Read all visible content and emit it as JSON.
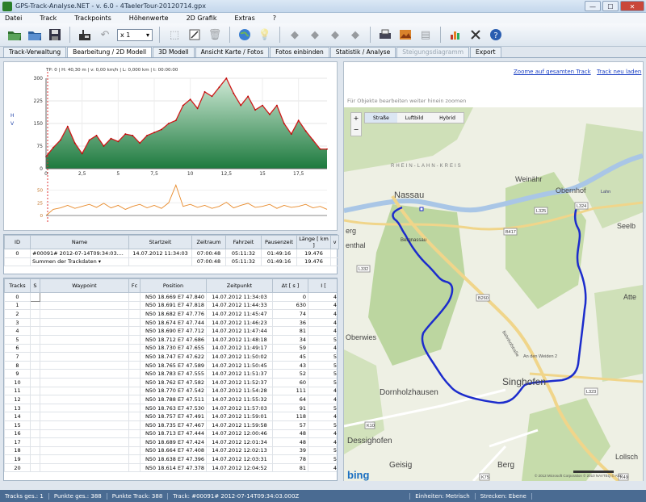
{
  "window": {
    "title": "GPS-Track-Analyse.NET  -  v. 6.0  -  4TaelerTour-20120714.gpx",
    "min": "—",
    "max": "☐",
    "close": "✕"
  },
  "menu": [
    "Datei",
    "Track",
    "Trackpoints",
    "Höhenwerte",
    "2D Grafik",
    "Extras",
    "?"
  ],
  "toolbar": {
    "zoom_value": "x 1"
  },
  "tabs": [
    {
      "label": "Track-Verwaltung",
      "state": "normal"
    },
    {
      "label": "Bearbeitung / 2D Modell",
      "state": "active"
    },
    {
      "label": "3D Modell",
      "state": "normal"
    },
    {
      "label": "Ansicht Karte / Fotos",
      "state": "normal"
    },
    {
      "label": "Fotos einbinden",
      "state": "normal"
    },
    {
      "label": "Statistik / Analyse",
      "state": "normal"
    },
    {
      "label": "Steigungsdiagramm",
      "state": "disabled"
    },
    {
      "label": "Export",
      "state": "normal"
    }
  ],
  "chart": {
    "info": "TP: 0 | H: 40,30 m | v: 0,00 km/h | L: 0,000 km | t: 00:00:00",
    "ylabel": "H\nV",
    "y_ticks": [
      "300",
      "225",
      "150",
      "75",
      "0"
    ],
    "x_ticks": [
      "0",
      "2,5",
      "5",
      "7,5",
      "10",
      "12,5",
      "15",
      "17,5"
    ],
    "speed_ticks": [
      "50",
      "25",
      "0"
    ]
  },
  "chart_data": [
    {
      "type": "area",
      "ylabel": "H",
      "ylim": [
        0,
        300
      ],
      "xlim": [
        0,
        19.476
      ],
      "x": [
        0,
        0.5,
        1,
        1.5,
        2,
        2.5,
        3,
        3.5,
        4,
        4.5,
        5,
        5.5,
        6,
        6.5,
        7,
        7.5,
        8,
        8.5,
        9,
        9.5,
        10,
        10.5,
        11,
        11.5,
        12,
        12.5,
        13,
        13.5,
        14,
        14.5,
        15,
        15.5,
        16,
        16.5,
        17,
        17.5,
        18,
        18.5,
        19,
        19.476
      ],
      "values": [
        40,
        70,
        95,
        140,
        85,
        50,
        95,
        110,
        75,
        100,
        90,
        115,
        110,
        85,
        110,
        120,
        130,
        150,
        160,
        210,
        230,
        200,
        255,
        240,
        270,
        300,
        250,
        210,
        240,
        195,
        210,
        180,
        210,
        150,
        115,
        160,
        125,
        95,
        65,
        65
      ]
    },
    {
      "type": "line",
      "ylabel": "V",
      "ylim": [
        0,
        70
      ],
      "xlim": [
        0,
        19.476
      ],
      "x": [
        0,
        0.5,
        1,
        1.5,
        2,
        2.5,
        3,
        3.5,
        4,
        4.5,
        5,
        5.5,
        6,
        6.5,
        7,
        7.5,
        8,
        8.5,
        9,
        9.5,
        10,
        10.5,
        11,
        11.5,
        12,
        12.5,
        13,
        13.5,
        14,
        14.5,
        15,
        15.5,
        16,
        16.5,
        17,
        17.5,
        18,
        18.5,
        19,
        19.476
      ],
      "values": [
        0,
        12,
        15,
        20,
        14,
        18,
        22,
        16,
        24,
        15,
        20,
        12,
        18,
        22,
        15,
        20,
        14,
        25,
        60,
        18,
        22,
        16,
        20,
        14,
        18,
        26,
        15,
        20,
        24,
        16,
        18,
        22,
        14,
        20,
        16,
        18,
        22,
        15,
        18,
        12
      ]
    }
  ],
  "tracks": {
    "headers": [
      "ID",
      "Name",
      "Startzeit",
      "Zeitraum",
      "Fahrzeit",
      "Pausenzeit",
      "Länge  [ km ]",
      "v"
    ],
    "rows": [
      [
        "0",
        "#00091# 2012-07-14T09:34:03....",
        "14.07.2012 11:34:03",
        "07:00:48",
        "05:11:32",
        "01:49:16",
        "19.476",
        ""
      ],
      [
        "",
        "Summen der Trackdaten ▾",
        "",
        "07:00:48",
        "05:11:32",
        "01:49:16",
        "19.476",
        ""
      ]
    ]
  },
  "waypoints": {
    "headers": [
      "Tracks",
      "S",
      "Waypoint",
      "Fc",
      "Position",
      "Zeitpunkt",
      "Δt\n[ s ]",
      "I\n["
    ],
    "rows": [
      [
        "0",
        "N50 18.669 E7 47.840",
        "14.07.2012 11:34:03",
        "0",
        "4"
      ],
      [
        "1",
        "N50 18.691 E7 47.818",
        "14.07.2012 11:44:33",
        "630",
        "4"
      ],
      [
        "2",
        "N50 18.682 E7 47.776",
        "14.07.2012 11:45:47",
        "74",
        "4"
      ],
      [
        "3",
        "N50 18.674 E7 47.744",
        "14.07.2012 11:46:23",
        "36",
        "4"
      ],
      [
        "4",
        "N50 18.690 E7 47.712",
        "14.07.2012 11:47:44",
        "81",
        "4"
      ],
      [
        "5",
        "N50 18.712 E7 47.686",
        "14.07.2012 11:48:18",
        "34",
        "5"
      ],
      [
        "6",
        "N50 18.730 E7 47.655",
        "14.07.2012 11:49:17",
        "59",
        "4"
      ],
      [
        "7",
        "N50 18.747 E7 47.622",
        "14.07.2012 11:50:02",
        "45",
        "5"
      ],
      [
        "8",
        "N50 18.765 E7 47.589",
        "14.07.2012 11:50:45",
        "43",
        "5"
      ],
      [
        "9",
        "N50 18.783 E7 47.555",
        "14.07.2012 11:51:37",
        "52",
        "5"
      ],
      [
        "10",
        "N50 18.762 E7 47.582",
        "14.07.2012 11:52:37",
        "60",
        "5"
      ],
      [
        "11",
        "N50 18.770 E7 47.542",
        "14.07.2012 11:54:28",
        "111",
        "4"
      ],
      [
        "12",
        "N50 18.788 E7 47.511",
        "14.07.2012 11:55:32",
        "64",
        "4"
      ],
      [
        "13",
        "N50 18.763 E7 47.530",
        "14.07.2012 11:57:03",
        "91",
        "5"
      ],
      [
        "14",
        "N50 18.757 E7 47.491",
        "14.07.2012 11:59:01",
        "118",
        "4"
      ],
      [
        "15",
        "N50 18.735 E7 47.467",
        "14.07.2012 11:59:58",
        "57",
        "5"
      ],
      [
        "16",
        "N50 18.713 E7 47.444",
        "14.07.2012 12:00:46",
        "48",
        "4"
      ],
      [
        "17",
        "N50 18.689 E7 47.424",
        "14.07.2012 12:01:34",
        "48",
        "4"
      ],
      [
        "18",
        "N50 18.664 E7 47.408",
        "14.07.2012 12:02:13",
        "39",
        "5"
      ],
      [
        "19",
        "N50 18.638 E7 47.396",
        "14.07.2012 12:03:31",
        "78",
        "5"
      ],
      [
        "20",
        "N50 18.614 E7 47.378",
        "14.07.2012 12:04:52",
        "81",
        "4"
      ]
    ]
  },
  "map": {
    "zoom_track_link": "Zoome auf gesamten Track",
    "reload_link": "Track neu laden",
    "hint": "Für Objekte bearbeiten weiter hinein zoomen",
    "map_types": [
      "Straße",
      "Luftbild",
      "Hybrid"
    ],
    "labels": {
      "nassau": "Nassau",
      "weinahr": "Weinähr",
      "obernhof": "Obernhof",
      "seelbach": "Seelb",
      "bergnassau": "Bergnassau",
      "berg_left": "erg",
      "ethal": "enthal",
      "oberwies": "Oberwies",
      "dornholz": "Dornholzhausen",
      "singhofen": "Singhofen",
      "dessighofen": "Dessighofen",
      "geisig": "Geisig",
      "berg": "Berg",
      "atten": "Atte",
      "lollsch": "Lollsch",
      "rhein_lahn": "RHEIN-LAHN-KREIS",
      "an_den_weiden": "An den Weiden 2",
      "bahnhofstr": "Bahnhofstraße",
      "lahn": "Lahn",
      "r_l324": "L324",
      "r_l325": "L325",
      "r_b417": "B417",
      "r_l332": "L332",
      "r_b260": "B260",
      "r_l323": "L323",
      "r_k10": "K10",
      "r_k75": "K75",
      "r_k49": "K49",
      "copyright": "© 2012 Microsoft Corporation  © 2010 NAVTEQ © AND",
      "bing": "bing"
    }
  },
  "status": {
    "tracks": "Tracks ges.:  1",
    "points": "Punkte ges.:  388",
    "track_points": "Punkte Track:  388",
    "track": "Track:  #00091# 2012-07-14T09:34:03.000Z",
    "units": "Einheiten: Metrisch",
    "road": "Strecken: Ebene"
  }
}
